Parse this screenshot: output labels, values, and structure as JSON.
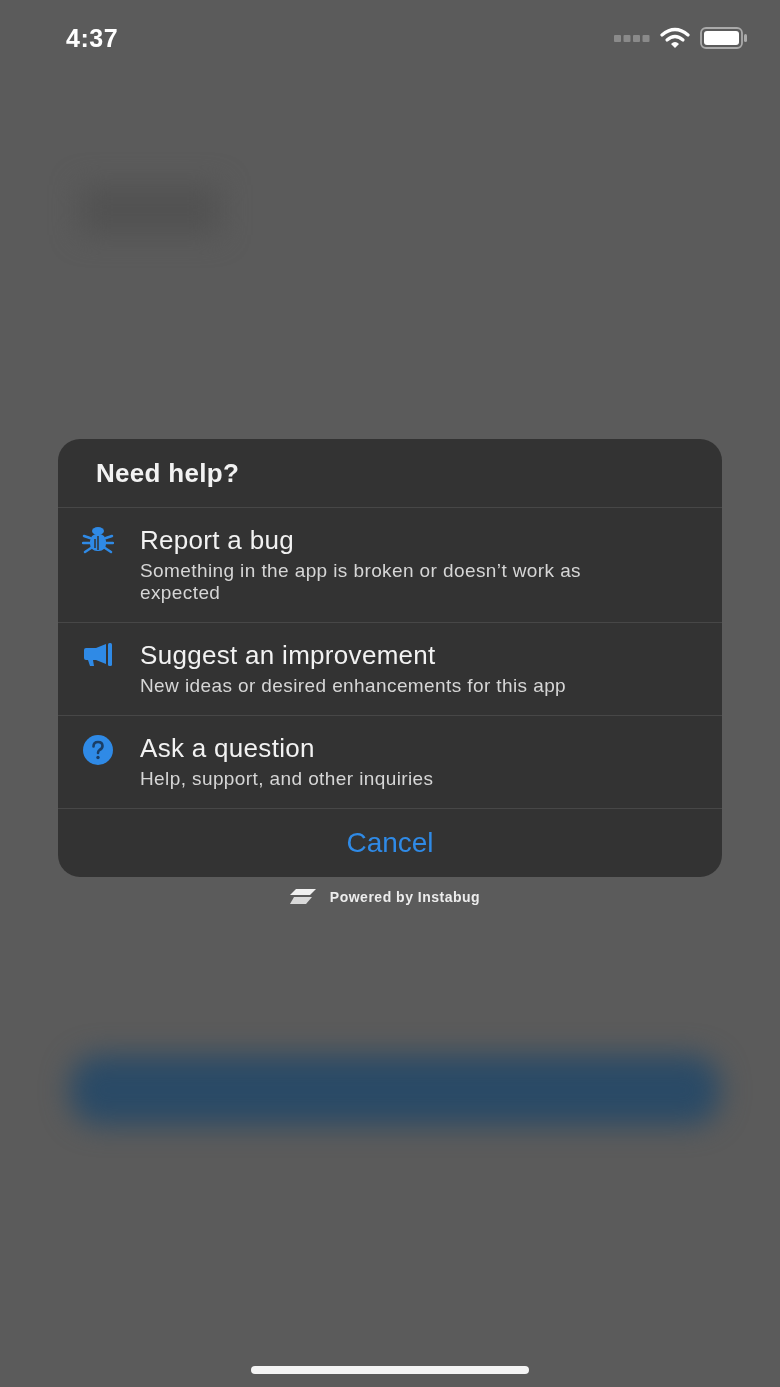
{
  "status_bar": {
    "time": "4:37"
  },
  "dialog": {
    "title": "Need help?",
    "options": [
      {
        "kind": "bug",
        "title": "Report a bug",
        "subtitle": "Something in the app is broken or doesn’t work as expected"
      },
      {
        "kind": "improvement",
        "title": "Suggest an improvement",
        "subtitle": "New ideas or desired enhancements for this app"
      },
      {
        "kind": "question",
        "title": "Ask a question",
        "subtitle": "Help, support, and other inquiries"
      }
    ],
    "cancel": "Cancel"
  },
  "footer": {
    "text": "Powered by Instabug"
  }
}
